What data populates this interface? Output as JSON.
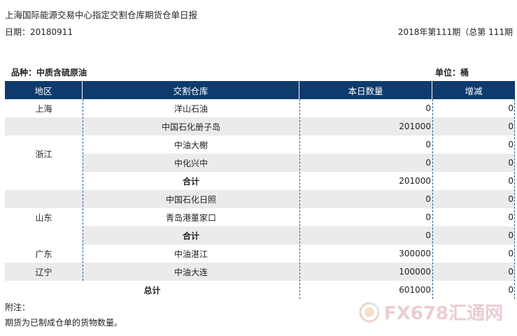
{
  "report": {
    "title": "上海国际能源交易中心指定交割仓库期货仓单日报",
    "date": "日期：20180911",
    "issue": "2018年第111期（总第 111期",
    "variety": "品种：中质含硫原油",
    "unit": "单位：桶"
  },
  "table": {
    "headers": [
      "地区",
      "交割仓库",
      "本日数量",
      "增减"
    ],
    "regions": [
      "上海",
      "浙江",
      "山东",
      "广东",
      "辽宁"
    ],
    "rows": [
      {
        "warehouse": "洋山石油",
        "qty": "0",
        "change": "0"
      },
      {
        "warehouse": "中国石化册子岛",
        "qty": "201000",
        "change": "0"
      },
      {
        "warehouse": "中油大榭",
        "qty": "0",
        "change": "0"
      },
      {
        "warehouse": "中化兴中",
        "qty": "0",
        "change": "0"
      },
      {
        "warehouse": "合计",
        "qty": "201000",
        "change": "0"
      },
      {
        "warehouse": "中国石化日照",
        "qty": "0",
        "change": "0"
      },
      {
        "warehouse": "青岛港董家口",
        "qty": "0",
        "change": "0"
      },
      {
        "warehouse": "合计",
        "qty": "0",
        "change": "0"
      },
      {
        "warehouse": "中油湛江",
        "qty": "300000",
        "change": "0"
      },
      {
        "warehouse": "中油大连",
        "qty": "100000",
        "change": "0"
      }
    ],
    "total": {
      "label": "总计",
      "qty": "601000",
      "change": "0"
    }
  },
  "notes": {
    "label": "附注：",
    "text": "期货为已制成仓单的货物数量。"
  },
  "watermark": {
    "text": "FX678汇通网",
    "color": "#d9a5a8"
  },
  "colors": {
    "header_bg": "#0e3a6e",
    "band_bg": "#ebebeb",
    "divider": "#2a5a9a"
  }
}
